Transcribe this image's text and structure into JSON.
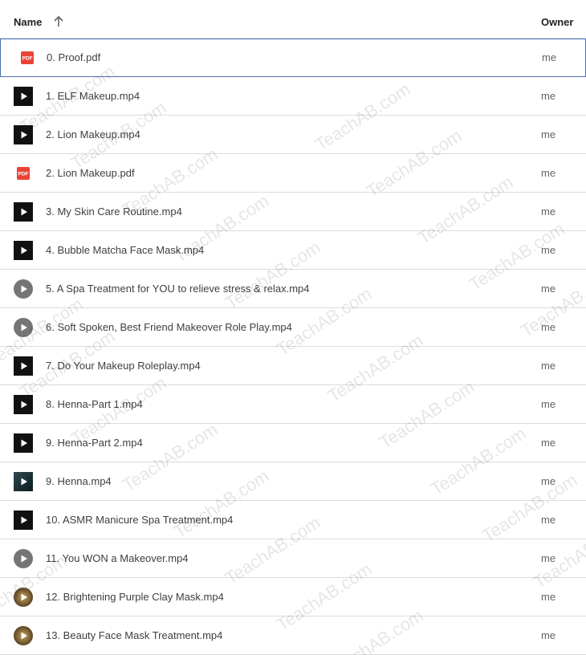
{
  "header": {
    "name_label": "Name",
    "owner_label": "Owner"
  },
  "watermark_text": "TeachAB.com",
  "files": [
    {
      "name": "0. Proof.pdf",
      "owner": "me",
      "type": "pdf",
      "icon": "pdf-icon",
      "selected": true
    },
    {
      "name": "1. ELF Makeup.mp4",
      "owner": "me",
      "type": "video-dark",
      "icon": "video-thumbnail-icon"
    },
    {
      "name": "2. Lion Makeup.mp4",
      "owner": "me",
      "type": "video-dark",
      "icon": "video-thumbnail-icon"
    },
    {
      "name": "2. Lion Makeup.pdf",
      "owner": "me",
      "type": "pdf",
      "icon": "pdf-icon"
    },
    {
      "name": "3. My Skin Care Routine.mp4",
      "owner": "me",
      "type": "video-dark",
      "icon": "video-thumbnail-icon"
    },
    {
      "name": "4. Bubble Matcha Face Mask.mp4",
      "owner": "me",
      "type": "video-dark",
      "icon": "video-thumbnail-icon"
    },
    {
      "name": "5. A Spa Treatment for YOU to relieve stress & relax.mp4",
      "owner": "me",
      "type": "video-circle",
      "icon": "play-circle-icon"
    },
    {
      "name": "6. Soft Spoken, Best Friend Makeover Role Play.mp4",
      "owner": "me",
      "type": "video-circle",
      "icon": "play-circle-icon"
    },
    {
      "name": "7. Do Your Makeup Roleplay.mp4",
      "owner": "me",
      "type": "video-dark",
      "icon": "video-thumbnail-icon"
    },
    {
      "name": "8. Henna-Part 1.mp4",
      "owner": "me",
      "type": "video-dark",
      "icon": "video-thumbnail-icon"
    },
    {
      "name": "9. Henna-Part 2.mp4",
      "owner": "me",
      "type": "video-dark",
      "icon": "video-thumbnail-icon"
    },
    {
      "name": "9. Henna.mp4",
      "owner": "me",
      "type": "video-teal",
      "icon": "video-thumbnail-icon"
    },
    {
      "name": "10. ASMR Manicure Spa Treatment.mp4",
      "owner": "me",
      "type": "video-dark",
      "icon": "video-thumbnail-icon"
    },
    {
      "name": "11. You WON a Makeover.mp4",
      "owner": "me",
      "type": "video-circle",
      "icon": "play-circle-icon"
    },
    {
      "name": "12. Brightening Purple Clay Mask.mp4",
      "owner": "me",
      "type": "video-gold",
      "icon": "video-thumbnail-icon"
    },
    {
      "name": "13. Beauty Face Mask Treatment.mp4",
      "owner": "me",
      "type": "video-gold",
      "icon": "video-thumbnail-icon"
    }
  ],
  "colors": {
    "pdf_red": "#ea4335",
    "play_gray": "#757575",
    "selected_border": "#4a6fb3",
    "divider": "#dadce0"
  }
}
